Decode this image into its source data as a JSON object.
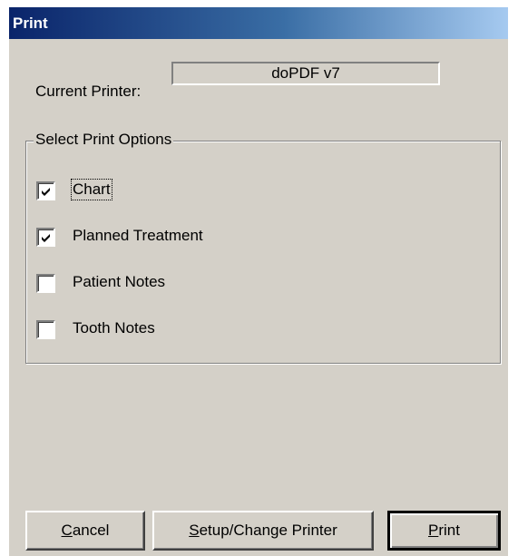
{
  "window": {
    "title": "Print"
  },
  "printer": {
    "label": "Current Printer:",
    "value": "doPDF v7"
  },
  "options": {
    "group_label": "Select Print Options",
    "items": [
      {
        "label": "Chart",
        "checked": true
      },
      {
        "label": "Planned Treatment",
        "checked": true
      },
      {
        "label": "Patient Notes",
        "checked": false
      },
      {
        "label": "Tooth Notes",
        "checked": false
      }
    ]
  },
  "buttons": {
    "cancel": {
      "mnemonic": "C",
      "rest": "ancel"
    },
    "setup": {
      "mnemonic": "S",
      "rest": "etup/Change Printer"
    },
    "print": {
      "mnemonic": "P",
      "rest": "rint"
    }
  }
}
